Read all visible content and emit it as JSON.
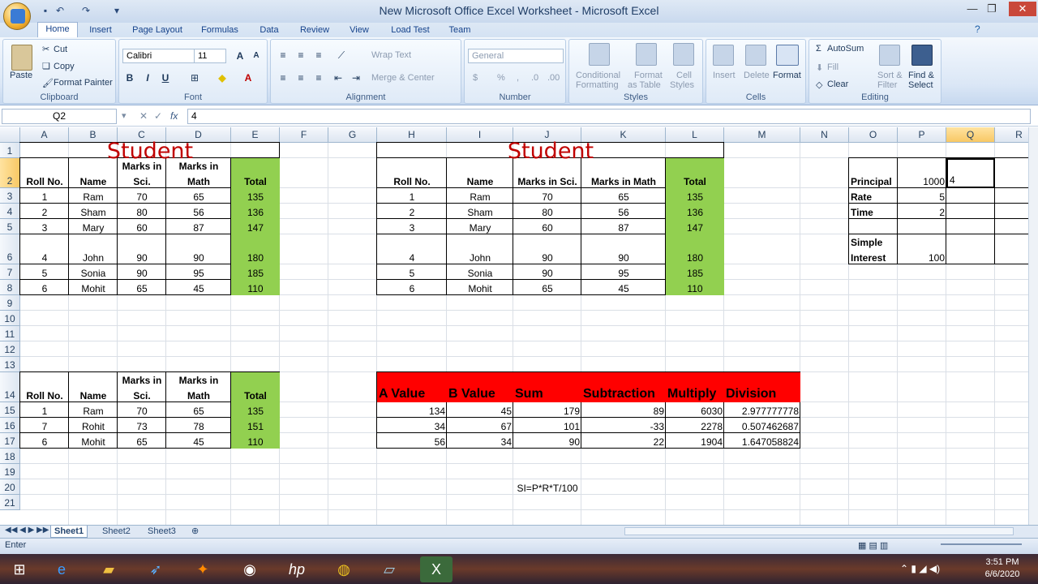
{
  "window": {
    "title": "New Microsoft Office Excel Worksheet - Microsoft Excel"
  },
  "tabs": [
    "Home",
    "Insert",
    "Page Layout",
    "Formulas",
    "Data",
    "Review",
    "View",
    "Load Test",
    "Team"
  ],
  "ribbon": {
    "clipboard": {
      "label": "Clipboard",
      "paste": "Paste",
      "cut": "Cut",
      "copy": "Copy",
      "format_painter": "Format Painter"
    },
    "font": {
      "label": "Font",
      "font_name": "Calibri",
      "font_size": "11"
    },
    "alignment": {
      "label": "Alignment",
      "wrap_text": "Wrap Text",
      "merge_center": "Merge & Center"
    },
    "number": {
      "label": "Number",
      "format": "General"
    },
    "styles": {
      "label": "Styles",
      "conditional": "Conditional",
      "conditional2": "Formatting",
      "format_as": "Format",
      "format_as2": "as Table",
      "cell": "Cell",
      "cell2": "Styles"
    },
    "cells": {
      "label": "Cells",
      "insert": "Insert",
      "delete": "Delete",
      "format": "Format"
    },
    "editing": {
      "label": "Editing",
      "autosum": "AutoSum",
      "fill": "Fill",
      "clear": "Clear",
      "sort": "Sort &",
      "sort2": "Filter",
      "find": "Find &",
      "find2": "Select"
    }
  },
  "formula_bar": {
    "name_box": "Q2",
    "fx": "fx",
    "content": "4"
  },
  "columns": [
    "A",
    "B",
    "C",
    "D",
    "E",
    "F",
    "G",
    "H",
    "I",
    "J",
    "K",
    "L",
    "M",
    "N",
    "O",
    "P",
    "Q",
    "R"
  ],
  "rows": [
    "1",
    "2",
    "3",
    "4",
    "5",
    "6",
    "7",
    "8",
    "9",
    "10",
    "11",
    "12",
    "13",
    "14",
    "15",
    "16",
    "17",
    "18",
    "19",
    "20",
    "21"
  ],
  "table1": {
    "title": "Student",
    "headers": [
      "Roll No.",
      "Name",
      "Marks in",
      "Sci.",
      "Marks in",
      "Math",
      "Total"
    ],
    "rows": [
      [
        "1",
        "Ram",
        "70",
        "65",
        "135"
      ],
      [
        "2",
        "Sham",
        "80",
        "56",
        "136"
      ],
      [
        "3",
        "Mary",
        "60",
        "87",
        "147"
      ],
      [
        "4",
        "John",
        "90",
        "90",
        "180"
      ],
      [
        "5",
        "Sonia",
        "90",
        "95",
        "185"
      ],
      [
        "6",
        "Mohit",
        "65",
        "45",
        "110"
      ]
    ]
  },
  "table2": {
    "title": "Student",
    "headers": [
      "Roll No.",
      "Name",
      "Marks in Sci.",
      "Marks in Math",
      "Total"
    ],
    "rows": [
      [
        "1",
        "Ram",
        "70",
        "65",
        "135"
      ],
      [
        "2",
        "Sham",
        "80",
        "56",
        "136"
      ],
      [
        "3",
        "Mary",
        "60",
        "87",
        "147"
      ],
      [
        "4",
        "John",
        "90",
        "90",
        "180"
      ],
      [
        "5",
        "Sonia",
        "90",
        "95",
        "185"
      ],
      [
        "6",
        "Mohit",
        "65",
        "45",
        "110"
      ]
    ]
  },
  "table3": {
    "headers": [
      "Roll No.",
      "Name",
      "Marks in",
      "Sci.",
      "Marks in",
      "Math",
      "Total"
    ],
    "rows": [
      [
        "1",
        "Ram",
        "70",
        "65",
        "135"
      ],
      [
        "7",
        "Rohit",
        "73",
        "78",
        "151"
      ],
      [
        "6",
        "Mohit",
        "65",
        "45",
        "110"
      ]
    ]
  },
  "table4": {
    "headers": [
      "A Value",
      "B Value",
      "Sum",
      "Subtraction",
      "Multiply",
      "Division"
    ],
    "rows": [
      [
        "134",
        "45",
        "179",
        "89",
        "6030",
        "2.977777778"
      ],
      [
        "34",
        "67",
        "101",
        "-33",
        "2278",
        "0.507462687"
      ],
      [
        "56",
        "34",
        "90",
        "22",
        "1904",
        "1.647058824"
      ]
    ]
  },
  "interest": {
    "principal_label": "Principal",
    "principal": "1000",
    "editing": "4",
    "rate_label": "Rate",
    "rate": "5",
    "time_label": "Time",
    "time": "2",
    "si_label1": "Simple",
    "si_label2": "Interest",
    "si": "100"
  },
  "formula_note": "SI=P*R*T/100",
  "sheets": [
    "Sheet1",
    "Sheet2",
    "Sheet3"
  ],
  "status": {
    "mode": "Enter"
  },
  "clock": {
    "time": "3:51 PM",
    "date": "6/6/2020"
  },
  "colors": {
    "green": "#92d050",
    "red": "#ff0000",
    "title_red": "#c00000"
  }
}
